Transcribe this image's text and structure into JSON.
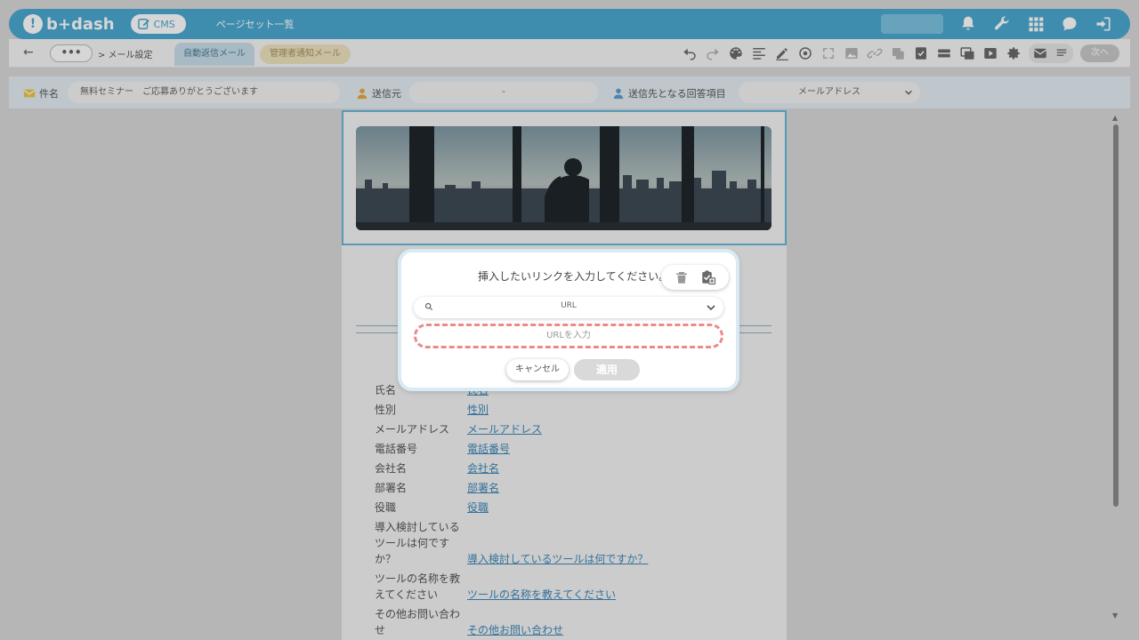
{
  "header": {
    "logo_text": "b+dash",
    "cms_label": "CMS",
    "nav_title": "ページセット一覧",
    "icons": [
      "bell-icon",
      "wrench-icon",
      "grid-icon",
      "chat-icon",
      "logout-icon"
    ]
  },
  "toolbar": {
    "back": "←",
    "more": "•••",
    "breadcrumb": "> メール設定",
    "tab_active": "自動返信メール",
    "tab_other": "管理者通知メール",
    "next_label": "次へ"
  },
  "fields": {
    "subject_label": "件名",
    "subject_value": "無料セミナー　ご応募ありがとうございます",
    "sender_label": "送信元",
    "sender_value": "-",
    "recipient_label": "送信先となる回答項目",
    "recipient_value": "メールアドレス"
  },
  "form_rows": [
    {
      "key": "氏名",
      "value": "氏名"
    },
    {
      "key": "性別",
      "value": "性別"
    },
    {
      "key": "メールアドレス",
      "value": "メールアドレス"
    },
    {
      "key": "電話番号",
      "value": "電話番号"
    },
    {
      "key": "会社名",
      "value": "会社名"
    },
    {
      "key": "部署名",
      "value": "部署名"
    },
    {
      "key": "役職",
      "value": "役職"
    },
    {
      "key": "導入検討しているツールは何ですか？",
      "value": "導入検討しているツールは何ですか？"
    },
    {
      "key": "ツールの名称を教えてください",
      "value": "ツールの名称を教えてください"
    },
    {
      "key": "その他お問い合わせ",
      "value": "その他お問い合わせ"
    }
  ],
  "dialog": {
    "title": "挿入したいリンクを入力してください。",
    "select_value": "URL",
    "url_placeholder": "URLを入力",
    "cancel_label": "キャンセル",
    "apply_label": "適用"
  },
  "colors": {
    "brand": "#4ba9d1",
    "link": "#3d88b8",
    "highlight_dash": "#e98b8b"
  }
}
